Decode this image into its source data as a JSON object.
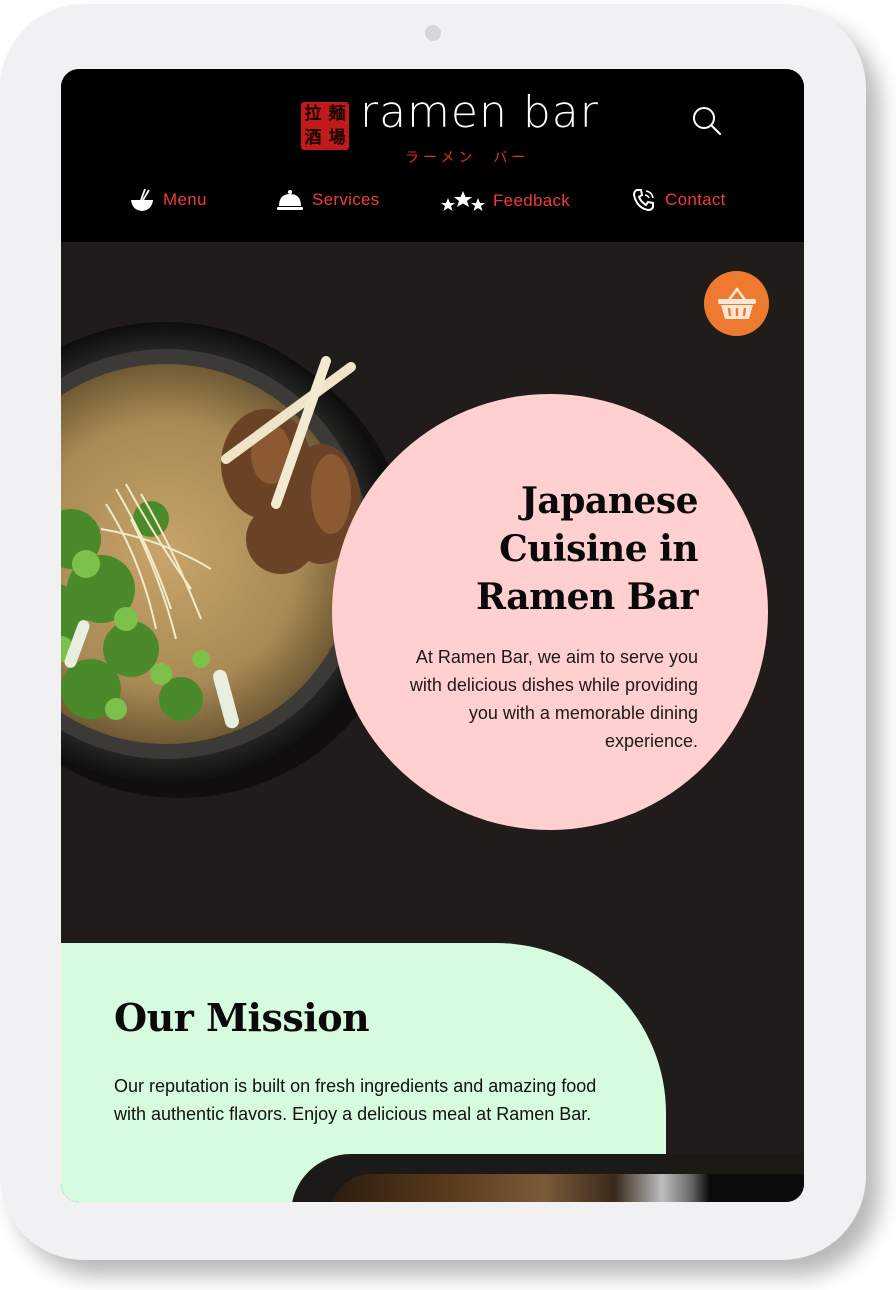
{
  "header": {
    "logo_stamp_chars": [
      "拉",
      "麺",
      "酒",
      "場"
    ],
    "logo_name": "ramen bar",
    "logo_sub": "ラーメン  バー",
    "search_icon": "search-icon"
  },
  "nav": {
    "items": [
      {
        "label": "Menu",
        "icon": "bowl-icon"
      },
      {
        "label": "Services",
        "icon": "cloche-icon"
      },
      {
        "label": "Feedback",
        "icon": "stars-icon"
      },
      {
        "label": "Contact",
        "icon": "phone-icon"
      }
    ]
  },
  "hero": {
    "title": "Japanese Cuisine in Ramen Bar",
    "text": "At Ramen Bar, we aim to serve you with delicious dishes while providing you with a memorable dining experience.",
    "cart_icon": "basket-icon"
  },
  "mission": {
    "title": "Our Mission",
    "text": "Our reputation is built on fresh ingredients and amazing food with authentic flavors. Enjoy a delicious meal at Ramen Bar."
  },
  "colors": {
    "header_bg": "#000000",
    "hero_bg": "#1f1c19",
    "accent_red": "#ef3c36",
    "hero_circle": "#ffd0cf",
    "mission_bg": "#d6fbdf",
    "basket": "#ee7a2f"
  }
}
